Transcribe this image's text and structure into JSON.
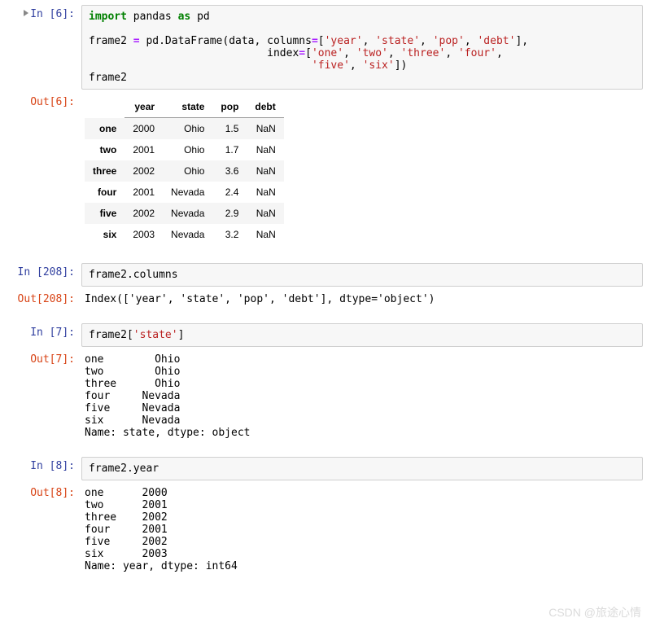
{
  "cells": {
    "c1": {
      "in_prompt": "In  [6]:",
      "code_lines": [
        [
          {
            "t": "import",
            "c": "kw"
          },
          {
            "t": " pandas ",
            "c": ""
          },
          {
            "t": "as",
            "c": "kw"
          },
          {
            "t": " pd",
            "c": ""
          }
        ],
        [
          {
            "t": "",
            "c": ""
          }
        ],
        [
          {
            "t": "frame2 ",
            "c": ""
          },
          {
            "t": "=",
            "c": "op"
          },
          {
            "t": " pd",
            "c": ""
          },
          {
            "t": ".",
            "c": ""
          },
          {
            "t": "DataFrame(data, columns",
            "c": ""
          },
          {
            "t": "=",
            "c": "op"
          },
          {
            "t": "[",
            "c": ""
          },
          {
            "t": "'year'",
            "c": "str"
          },
          {
            "t": ", ",
            "c": ""
          },
          {
            "t": "'state'",
            "c": "str"
          },
          {
            "t": ", ",
            "c": ""
          },
          {
            "t": "'pop'",
            "c": "str"
          },
          {
            "t": ", ",
            "c": ""
          },
          {
            "t": "'debt'",
            "c": "str"
          },
          {
            "t": "],",
            "c": ""
          }
        ],
        [
          {
            "t": "                            index",
            "c": ""
          },
          {
            "t": "=",
            "c": "op"
          },
          {
            "t": "[",
            "c": ""
          },
          {
            "t": "'one'",
            "c": "str"
          },
          {
            "t": ", ",
            "c": ""
          },
          {
            "t": "'two'",
            "c": "str"
          },
          {
            "t": ", ",
            "c": ""
          },
          {
            "t": "'three'",
            "c": "str"
          },
          {
            "t": ", ",
            "c": ""
          },
          {
            "t": "'four'",
            "c": "str"
          },
          {
            "t": ",",
            "c": ""
          }
        ],
        [
          {
            "t": "                                   ",
            "c": ""
          },
          {
            "t": "'five'",
            "c": "str"
          },
          {
            "t": ", ",
            "c": ""
          },
          {
            "t": "'six'",
            "c": "str"
          },
          {
            "t": "])",
            "c": ""
          }
        ],
        [
          {
            "t": "frame2",
            "c": ""
          }
        ]
      ],
      "out_prompt": "Out[6]:",
      "table": {
        "columns": [
          "year",
          "state",
          "pop",
          "debt"
        ],
        "index": [
          "one",
          "two",
          "three",
          "four",
          "five",
          "six"
        ],
        "rows": [
          [
            "2000",
            "Ohio",
            "1.5",
            "NaN"
          ],
          [
            "2001",
            "Ohio",
            "1.7",
            "NaN"
          ],
          [
            "2002",
            "Ohio",
            "3.6",
            "NaN"
          ],
          [
            "2001",
            "Nevada",
            "2.4",
            "NaN"
          ],
          [
            "2002",
            "Nevada",
            "2.9",
            "NaN"
          ],
          [
            "2003",
            "Nevada",
            "3.2",
            "NaN"
          ]
        ]
      }
    },
    "c2": {
      "in_prompt": "In  [208]:",
      "code_lines": [
        [
          {
            "t": "frame2",
            "c": ""
          },
          {
            "t": ".",
            "c": ""
          },
          {
            "t": "columns",
            "c": ""
          }
        ]
      ],
      "out_prompt": "Out[208]:",
      "output_text": "Index(['year', 'state', 'pop', 'debt'], dtype='object')"
    },
    "c3": {
      "in_prompt": "In  [7]:",
      "code_lines": [
        [
          {
            "t": "frame2[",
            "c": ""
          },
          {
            "t": "'state'",
            "c": "str"
          },
          {
            "t": "]",
            "c": ""
          }
        ]
      ],
      "out_prompt": "Out[7]:",
      "output_text": "one        Ohio\ntwo        Ohio\nthree      Ohio\nfour     Nevada\nfive     Nevada\nsix      Nevada\nName: state, dtype: object"
    },
    "c4": {
      "in_prompt": "In  [8]:",
      "code_lines": [
        [
          {
            "t": "frame2",
            "c": ""
          },
          {
            "t": ".",
            "c": ""
          },
          {
            "t": "year",
            "c": ""
          }
        ]
      ],
      "out_prompt": "Out[8]:",
      "output_text": "one      2000\ntwo      2001\nthree    2002\nfour     2001\nfive     2002\nsix      2003\nName: year, dtype: int64"
    }
  },
  "watermark": "CSDN @旅途心情"
}
